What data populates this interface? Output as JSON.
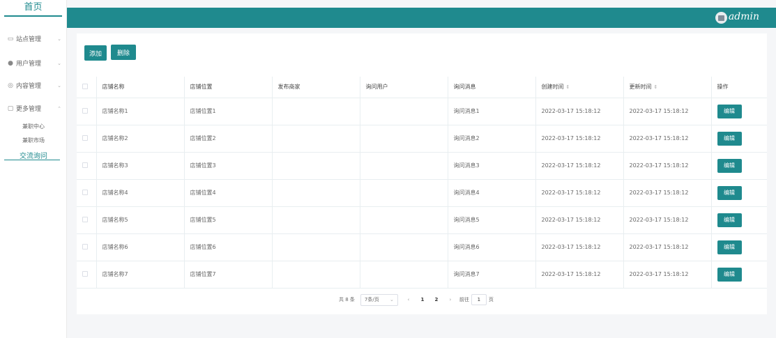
{
  "sidebar": {
    "home": "首页",
    "menus": [
      {
        "icon": "monitor-icon",
        "glyph": "▭",
        "label": "站点管理",
        "chevron": "⌄"
      },
      {
        "icon": "user-icon",
        "glyph": "●",
        "label": "用户管理",
        "chevron": "⌄"
      },
      {
        "icon": "content-icon",
        "glyph": "◎",
        "label": "内容管理",
        "chevron": "⌄"
      },
      {
        "icon": "more-icon",
        "glyph": "▢",
        "label": "更多管理",
        "chevron": "⌃"
      }
    ],
    "submenus": [
      {
        "label": "兼职中心"
      },
      {
        "label": "兼职市场"
      },
      {
        "label": "交流询问"
      }
    ]
  },
  "header": {
    "username": "admin"
  },
  "toolbar": {
    "add_label": "添加",
    "delete_label": "删除"
  },
  "table": {
    "columns": [
      "店铺名称",
      "店铺位置",
      "发布商家",
      "询问用户",
      "询问消息",
      "创建时间",
      "更新时间",
      "操作"
    ],
    "sort_glyph": "⇕",
    "edit_label": "编辑",
    "rows": [
      {
        "name": "店铺名称1",
        "location": "店铺位置1",
        "merchant": "",
        "user": "",
        "message": "询问消息1",
        "created": "2022-03-17 15:18:12",
        "updated": "2022-03-17 15:18:12"
      },
      {
        "name": "店铺名称2",
        "location": "店铺位置2",
        "merchant": "",
        "user": "",
        "message": "询问消息2",
        "created": "2022-03-17 15:18:12",
        "updated": "2022-03-17 15:18:12"
      },
      {
        "name": "店铺名称3",
        "location": "店铺位置3",
        "merchant": "",
        "user": "",
        "message": "询问消息3",
        "created": "2022-03-17 15:18:12",
        "updated": "2022-03-17 15:18:12"
      },
      {
        "name": "店铺名称4",
        "location": "店铺位置4",
        "merchant": "",
        "user": "",
        "message": "询问消息4",
        "created": "2022-03-17 15:18:12",
        "updated": "2022-03-17 15:18:12"
      },
      {
        "name": "店铺名称5",
        "location": "店铺位置5",
        "merchant": "",
        "user": "",
        "message": "询问消息5",
        "created": "2022-03-17 15:18:12",
        "updated": "2022-03-17 15:18:12"
      },
      {
        "name": "店铺名称6",
        "location": "店铺位置6",
        "merchant": "",
        "user": "",
        "message": "询问消息6",
        "created": "2022-03-17 15:18:12",
        "updated": "2022-03-17 15:18:12"
      },
      {
        "name": "店铺名称7",
        "location": "店铺位置7",
        "merchant": "",
        "user": "",
        "message": "询问消息7",
        "created": "2022-03-17 15:18:12",
        "updated": "2022-03-17 15:18:12"
      }
    ]
  },
  "pagination": {
    "total": "共 8 条",
    "page_size": "7条/页",
    "prev": "‹",
    "pages": [
      "1",
      "2"
    ],
    "next": "›",
    "goto_label": "前往",
    "goto_value": "1",
    "goto_suffix": "页"
  },
  "colors": {
    "primary": "#1f8a8e",
    "background": "#f5f6f8"
  }
}
